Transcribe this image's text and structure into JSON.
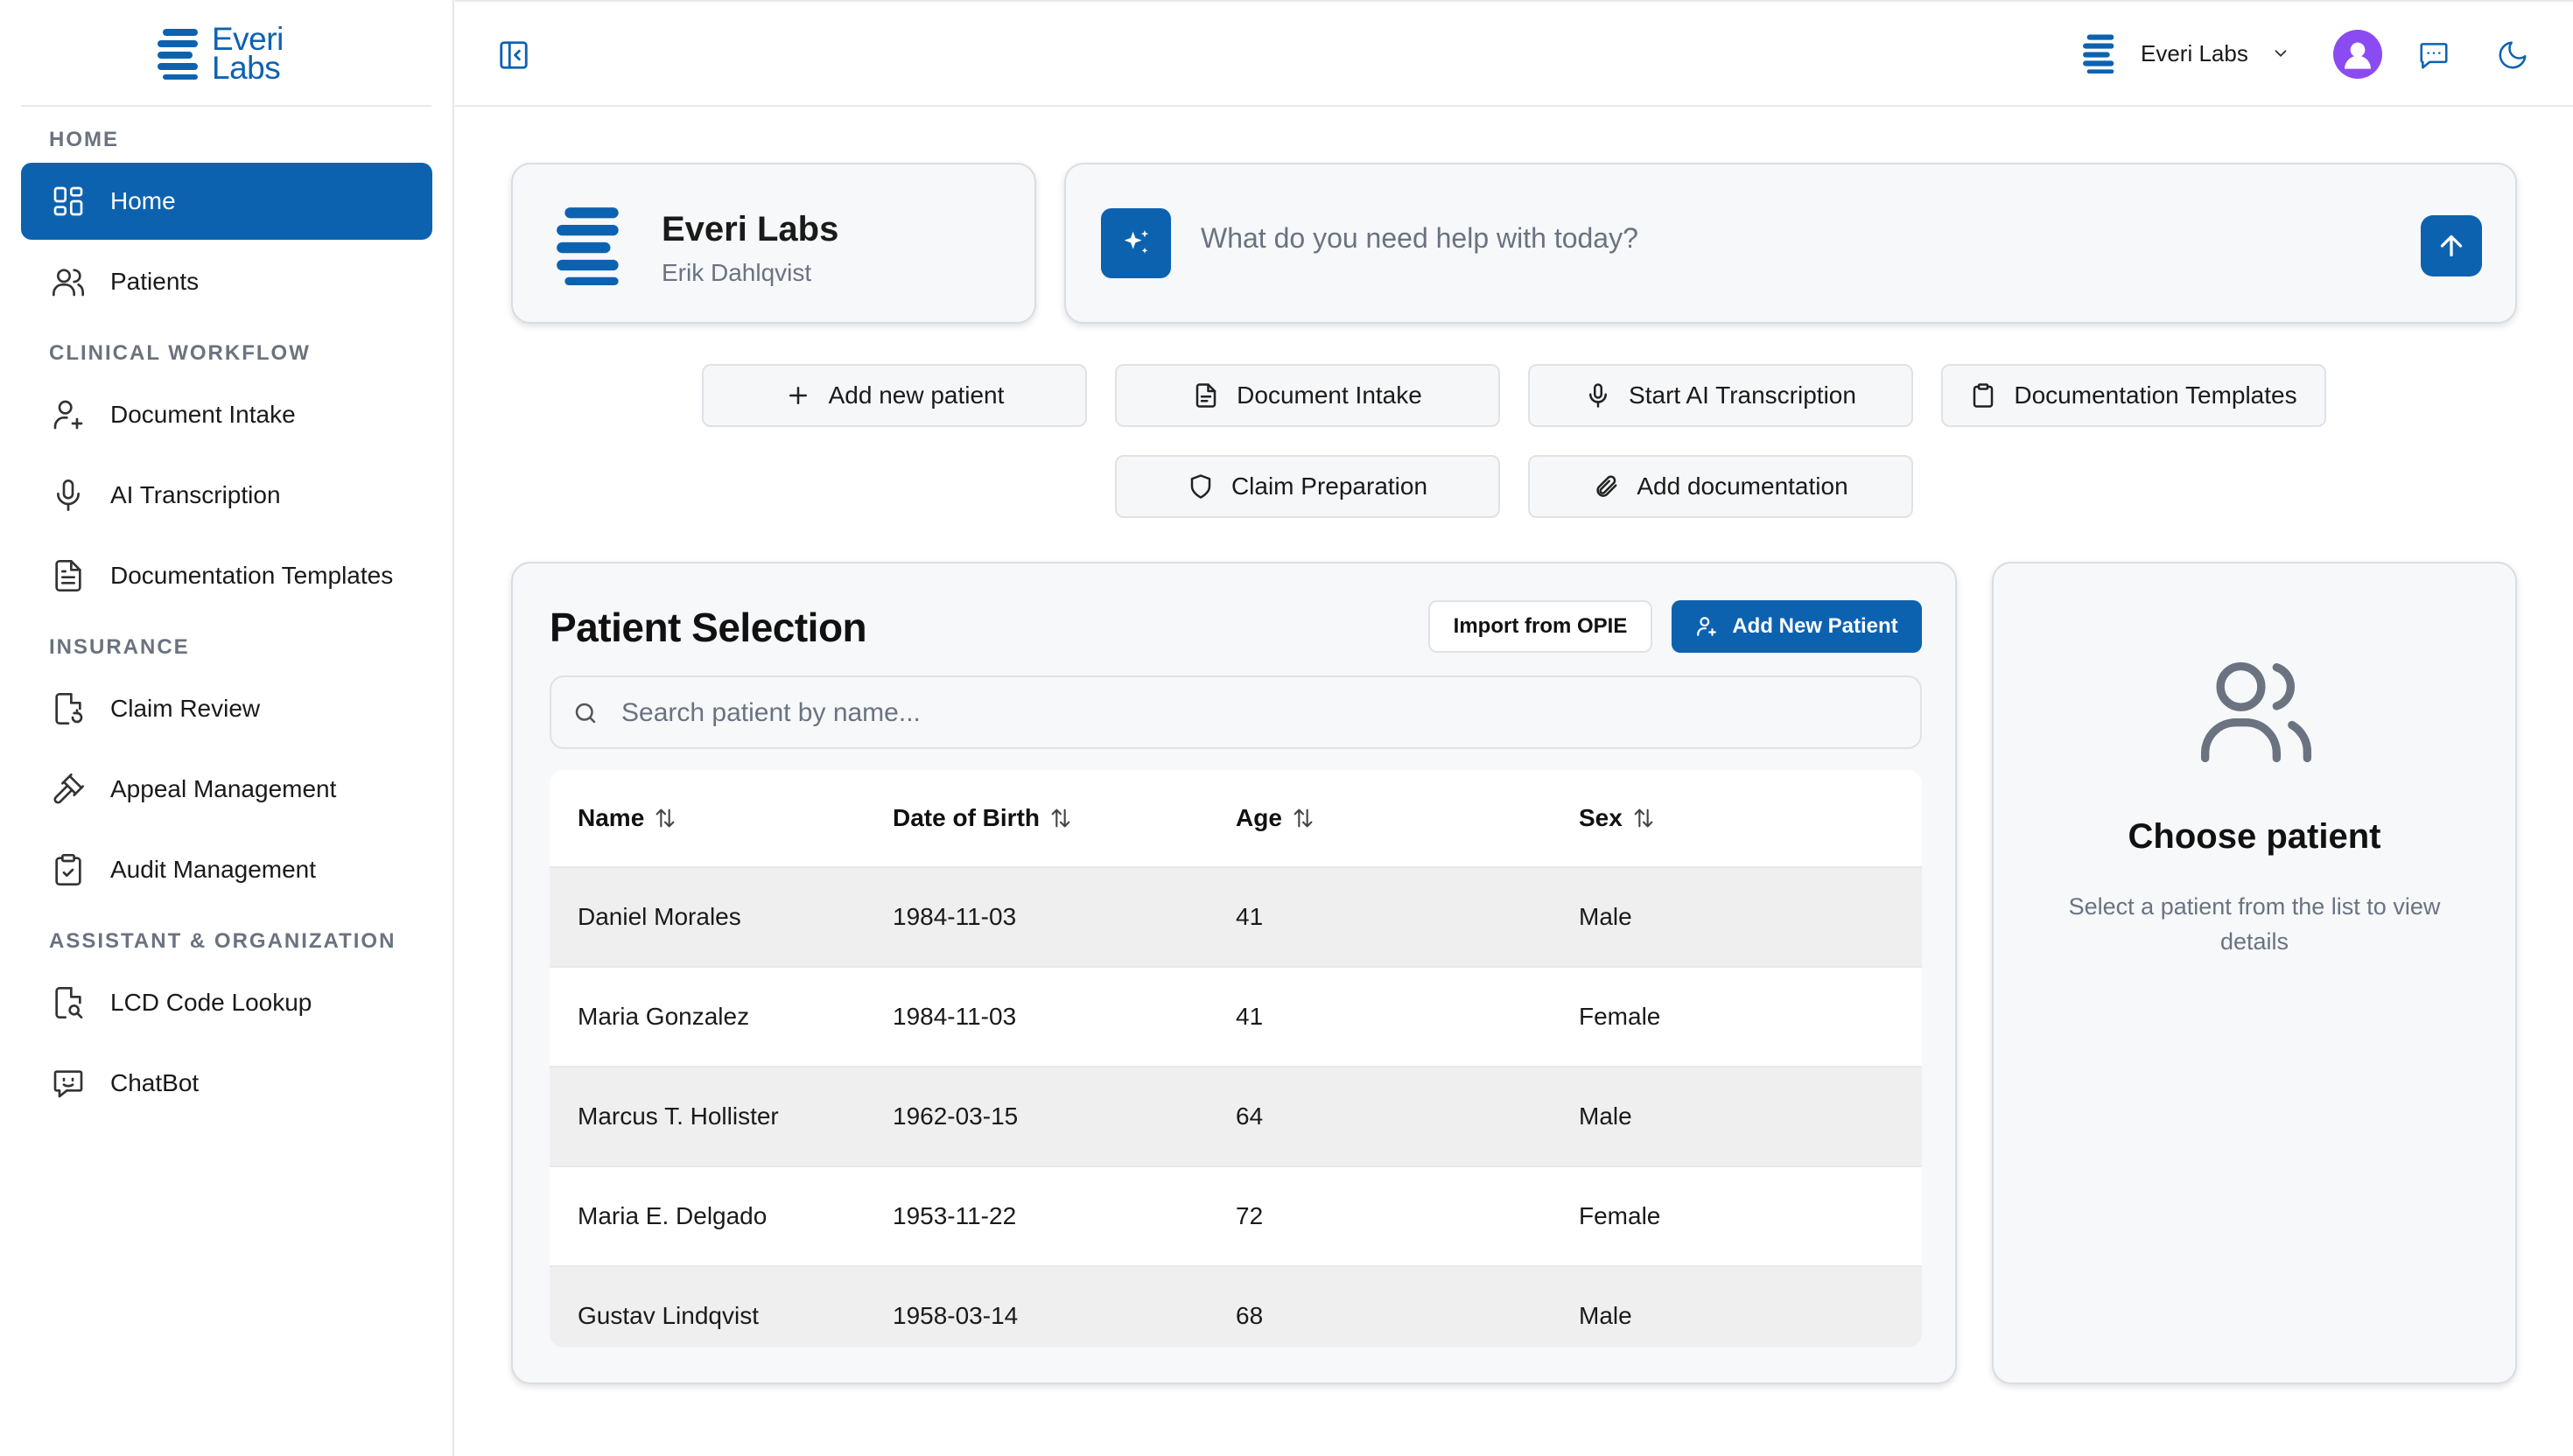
{
  "brand": {
    "line1": "Everi",
    "line2": "Labs",
    "accent_color": "#0d62b0"
  },
  "sidebar": {
    "sections": [
      {
        "title": "HOME",
        "items": [
          {
            "label": "Home",
            "icon": "grid-icon",
            "active": true
          },
          {
            "label": "Patients",
            "icon": "users-icon"
          }
        ]
      },
      {
        "title": "CLINICAL WORKFLOW",
        "items": [
          {
            "label": "Document Intake",
            "icon": "user-plus-icon"
          },
          {
            "label": "AI Transcription",
            "icon": "microphone-icon"
          },
          {
            "label": "Documentation Templates",
            "icon": "file-text-icon"
          }
        ]
      },
      {
        "title": "INSURANCE",
        "items": [
          {
            "label": "Claim Review",
            "icon": "file-refresh-icon"
          },
          {
            "label": "Appeal Management",
            "icon": "gavel-icon"
          },
          {
            "label": "Audit Management",
            "icon": "clipboard-check-icon"
          }
        ]
      },
      {
        "title": "ASSISTANT & ORGANIZATION",
        "items": [
          {
            "label": "LCD Code Lookup",
            "icon": "file-search-icon"
          },
          {
            "label": "ChatBot",
            "icon": "chat-bot-icon"
          }
        ]
      }
    ]
  },
  "topbar": {
    "org_name": "Everi Labs",
    "avatar_color": "#8b4bf2"
  },
  "org_card": {
    "name": "Everi Labs",
    "user": "Erik Dahlqvist"
  },
  "ask": {
    "placeholder": "What do you need help with today?"
  },
  "quick_actions": [
    {
      "label": "Add new patient",
      "icon": "plus-icon"
    },
    {
      "label": "Document Intake",
      "icon": "document-icon"
    },
    {
      "label": "Start AI Transcription",
      "icon": "microphone-icon"
    },
    {
      "label": "Documentation Templates",
      "icon": "clipboard-icon"
    },
    {
      "label": "Claim Preparation",
      "icon": "shield-icon"
    },
    {
      "label": "Add documentation",
      "icon": "paperclip-icon"
    }
  ],
  "patient_selection": {
    "title": "Patient Selection",
    "import_label": "Import from OPIE",
    "add_label": "Add New Patient",
    "search_placeholder": "Search patient by name...",
    "columns": [
      "Name",
      "Date of Birth",
      "Age",
      "Sex"
    ],
    "rows": [
      [
        "Daniel Morales",
        "1984-11-03",
        "41",
        "Male"
      ],
      [
        "Maria Gonzalez",
        "1984-11-03",
        "41",
        "Female"
      ],
      [
        "Marcus T. Hollister",
        "1962-03-15",
        "64",
        "Male"
      ],
      [
        "Maria E. Delgado",
        "1953-11-22",
        "72",
        "Female"
      ],
      [
        "Gustav Lindqvist",
        "1958-03-14",
        "68",
        "Male"
      ]
    ]
  },
  "choose_patient": {
    "title": "Choose patient",
    "subtitle": "Select a patient from the list to view details"
  }
}
